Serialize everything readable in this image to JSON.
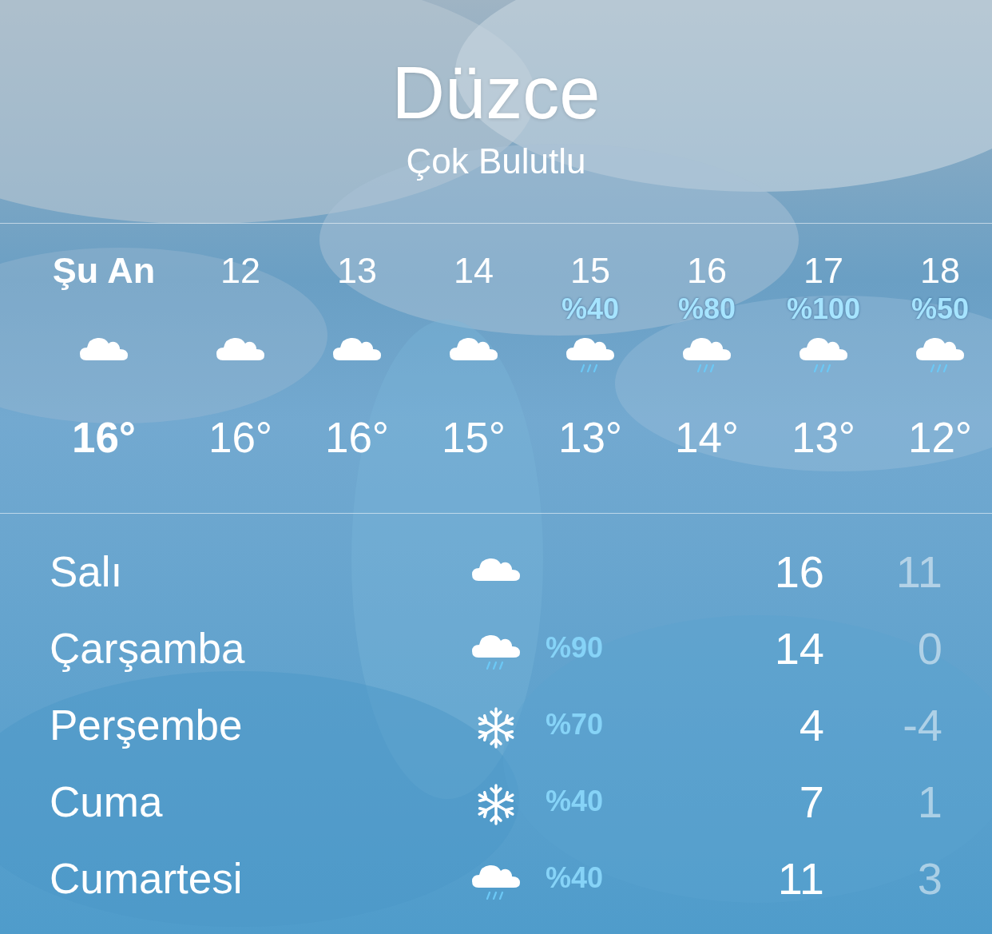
{
  "location": {
    "city": "Düzce",
    "condition": "Çok Bulutlu"
  },
  "hourly": [
    {
      "label": "Şu An",
      "kind": "cloud",
      "temp": "16°"
    },
    {
      "label": "12",
      "kind": "cloud",
      "temp": "16°"
    },
    {
      "label": "13",
      "kind": "cloud",
      "temp": "16°"
    },
    {
      "label": "14",
      "kind": "cloud",
      "temp": "15°"
    },
    {
      "label": "15",
      "chance": "%40",
      "kind": "rain",
      "temp": "13°"
    },
    {
      "label": "16",
      "chance": "%80",
      "kind": "rain",
      "temp": "14°"
    },
    {
      "label": "17",
      "chance": "%100",
      "kind": "rain",
      "temp": "13°"
    },
    {
      "label": "18",
      "chance": "%50",
      "kind": "rain",
      "temp": "12°"
    }
  ],
  "daily": [
    {
      "day": "Salı",
      "kind": "cloud",
      "high": "16",
      "low": "11"
    },
    {
      "day": "Çarşamba",
      "kind": "rain",
      "chance": "%90",
      "high": "14",
      "low": "0"
    },
    {
      "day": "Perşembe",
      "kind": "snow",
      "chance": "%70",
      "high": "4",
      "low": "-4"
    },
    {
      "day": "Cuma",
      "kind": "snow",
      "chance": "%40",
      "high": "7",
      "low": "1"
    },
    {
      "day": "Cumartesi",
      "kind": "rain",
      "chance": "%40",
      "high": "11",
      "low": "3"
    }
  ]
}
